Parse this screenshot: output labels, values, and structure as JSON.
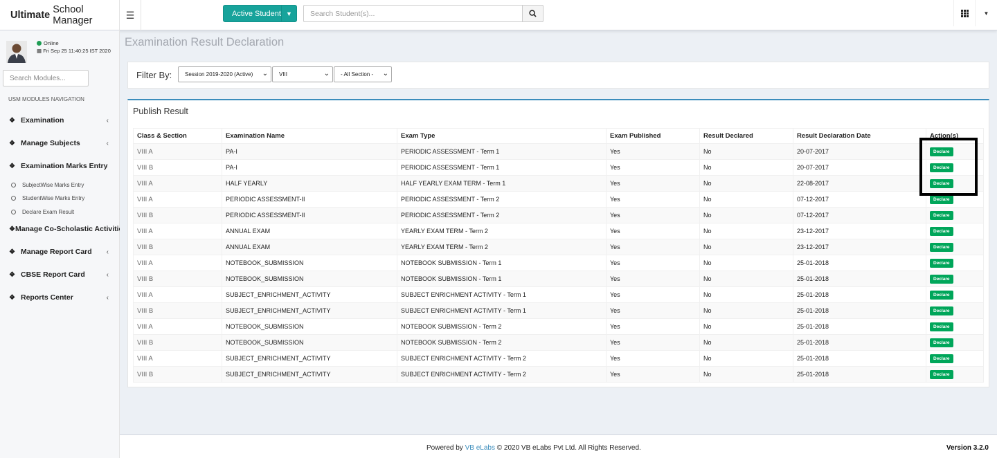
{
  "brand": {
    "bold": "Ultimate",
    "rest": "School Manager"
  },
  "topbar": {
    "active_student": "Active Student",
    "search_placeholder": "Search Student(s)..."
  },
  "user": {
    "status": "Online",
    "datetime": "Fri Sep 25 11:40:25 IST 2020"
  },
  "sidebar": {
    "search_placeholder": "Search Modules...",
    "heading": "USM MODULES NAVIGATION",
    "items": [
      {
        "label": "Examination"
      },
      {
        "label": "Manage Subjects"
      },
      {
        "label": "Examination Marks Entry"
      },
      {
        "label": "Manage Co-Scholastic Activities"
      },
      {
        "label": "Manage Report Card"
      },
      {
        "label": "CBSE Report Card"
      },
      {
        "label": "Reports Center"
      }
    ],
    "sub_items": [
      {
        "label": "SubjectWise Marks Entry"
      },
      {
        "label": "StudentWise Marks Entry"
      },
      {
        "label": "Declare Exam Result"
      }
    ]
  },
  "page": {
    "title": "Examination Result Declaration"
  },
  "filter": {
    "label": "Filter By:",
    "session": "Session 2019-2020 (Active)",
    "class": "VIII",
    "section": "- All Section -"
  },
  "result": {
    "title": "Publish Result",
    "headers": [
      "Class & Section",
      "Examination Name",
      "Exam Type",
      "Exam Published",
      "Result Declared",
      "Result Declaration Date",
      "Action(s)"
    ],
    "action_label": "Declare",
    "rows": [
      [
        "VIII A",
        "PA-I",
        "PERIODIC ASSESSMENT - Term 1",
        "Yes",
        "No",
        "20-07-2017"
      ],
      [
        "VIII B",
        "PA-I",
        "PERIODIC ASSESSMENT - Term 1",
        "Yes",
        "No",
        "20-07-2017"
      ],
      [
        "VIII A",
        "HALF YEARLY",
        "HALF YEARLY EXAM TERM - Term 1",
        "Yes",
        "No",
        "22-08-2017"
      ],
      [
        "VIII A",
        "PERIODIC ASSESSMENT-II",
        "PERIODIC ASSESSMENT - Term 2",
        "Yes",
        "No",
        "07-12-2017"
      ],
      [
        "VIII B",
        "PERIODIC ASSESSMENT-II",
        "PERIODIC ASSESSMENT - Term 2",
        "Yes",
        "No",
        "07-12-2017"
      ],
      [
        "VIII A",
        "ANNUAL EXAM",
        "YEARLY EXAM TERM - Term 2",
        "Yes",
        "No",
        "23-12-2017"
      ],
      [
        "VIII B",
        "ANNUAL EXAM",
        "YEARLY EXAM TERM - Term 2",
        "Yes",
        "No",
        "23-12-2017"
      ],
      [
        "VIII A",
        "NOTEBOOK_SUBMISSION",
        "NOTEBOOK SUBMISSION - Term 1",
        "Yes",
        "No",
        "25-01-2018"
      ],
      [
        "VIII B",
        "NOTEBOOK_SUBMISSION",
        "NOTEBOOK SUBMISSION - Term 1",
        "Yes",
        "No",
        "25-01-2018"
      ],
      [
        "VIII A",
        "SUBJECT_ENRICHMENT_ACTIVITY",
        "SUBJECT ENRICHMENT ACTIVITY - Term 1",
        "Yes",
        "No",
        "25-01-2018"
      ],
      [
        "VIII B",
        "SUBJECT_ENRICHMENT_ACTIVITY",
        "SUBJECT ENRICHMENT ACTIVITY - Term 1",
        "Yes",
        "No",
        "25-01-2018"
      ],
      [
        "VIII A",
        "NOTEBOOK_SUBMISSION",
        "NOTEBOOK SUBMISSION - Term 2",
        "Yes",
        "No",
        "25-01-2018"
      ],
      [
        "VIII B",
        "NOTEBOOK_SUBMISSION",
        "NOTEBOOK SUBMISSION - Term 2",
        "Yes",
        "No",
        "25-01-2018"
      ],
      [
        "VIII A",
        "SUBJECT_ENRICHMENT_ACTIVITY",
        "SUBJECT ENRICHMENT ACTIVITY - Term 2",
        "Yes",
        "No",
        "25-01-2018"
      ],
      [
        "VIII B",
        "SUBJECT_ENRICHMENT_ACTIVITY",
        "SUBJECT ENRICHMENT ACTIVITY - Term 2",
        "Yes",
        "No",
        "25-01-2018"
      ]
    ]
  },
  "footer": {
    "powered": "Powered by",
    "link": "VB eLabs",
    "copyright": "© 2020 VB eLabs Pvt Ltd. All Rights Reserved.",
    "version": "Version 3.2.0"
  },
  "colors": {
    "accent": "#17a39b",
    "declare": "#00a65a",
    "box_border": "#3c8dbc"
  }
}
